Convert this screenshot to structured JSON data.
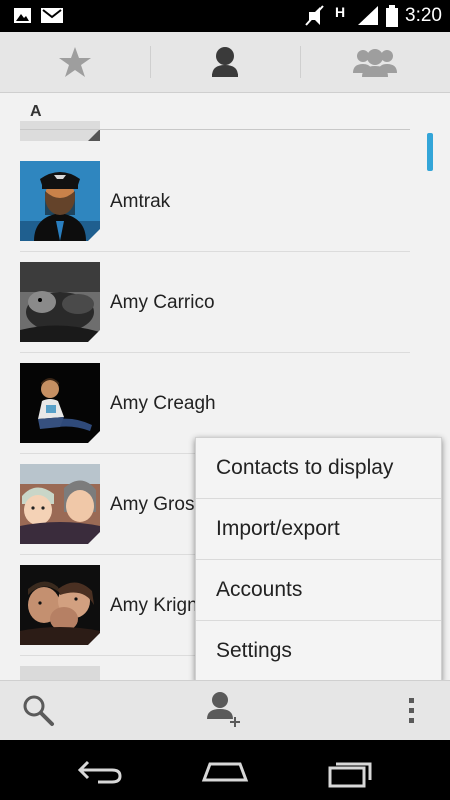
{
  "status_bar": {
    "time": "3:20",
    "network_type": "H",
    "icons": [
      "picture-icon",
      "gmail-icon",
      "mute-icon",
      "signal-icon",
      "battery-icon"
    ]
  },
  "tabs": [
    {
      "name": "favorites",
      "icon": "star-icon"
    },
    {
      "name": "contacts",
      "icon": "person-icon",
      "selected": true
    },
    {
      "name": "groups",
      "icon": "group-icon"
    }
  ],
  "section": {
    "letter": "A"
  },
  "contacts": [
    {
      "name": "Amtrak"
    },
    {
      "name": "Amy Carrico"
    },
    {
      "name": "Amy Creagh"
    },
    {
      "name": "Amy Gros"
    },
    {
      "name": "Amy Krign"
    }
  ],
  "menu": {
    "items": [
      "Contacts to display",
      "Import/export",
      "Accounts",
      "Settings"
    ]
  },
  "action_bar": {
    "icons": [
      "search-icon",
      "add-contact-icon",
      "overflow-menu-icon"
    ]
  },
  "nav_bar": {
    "icons": [
      "back-icon",
      "home-icon",
      "recents-icon"
    ]
  },
  "colors": {
    "accent": "#33a5d8",
    "status_bar": "#000000",
    "background": "#f2f2f2"
  }
}
